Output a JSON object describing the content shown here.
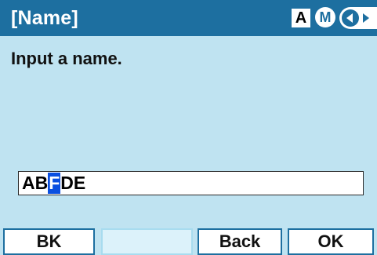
{
  "header": {
    "title": "[Name]",
    "mode_a": "A",
    "mode_m": "M",
    "nav_icon": "left-right-arrows-icon"
  },
  "main": {
    "prompt": "Input a name.",
    "input": {
      "before_cursor": "AB",
      "cursor_char": "F",
      "after_cursor": "DE"
    }
  },
  "softkeys": [
    {
      "label": "BK"
    },
    {
      "label": ""
    },
    {
      "label": "Back"
    },
    {
      "label": "OK"
    }
  ],
  "colors": {
    "titlebar": "#1d6fa0",
    "background": "#bfe3f1",
    "cursor": "#0a4fe0"
  }
}
